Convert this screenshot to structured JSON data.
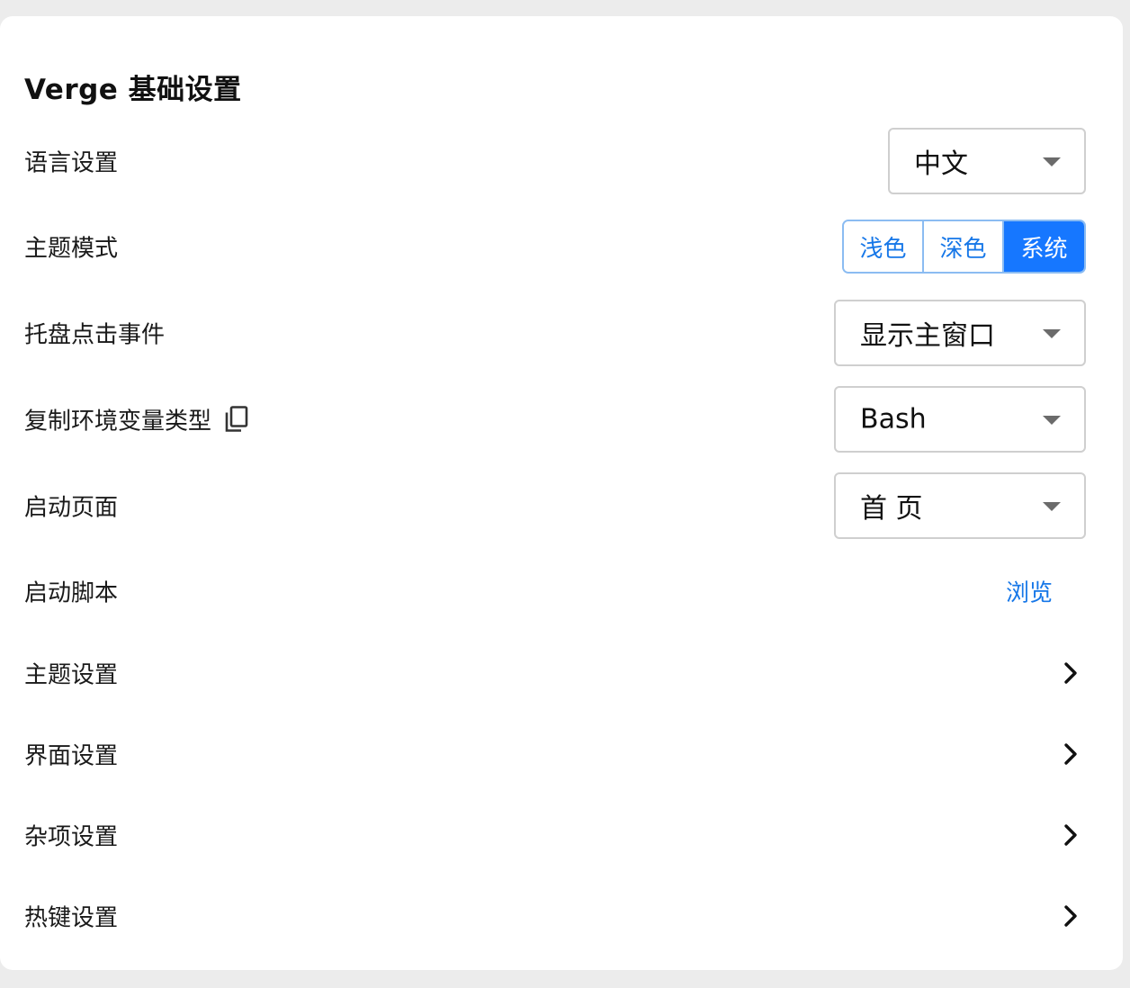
{
  "card": {
    "title": "Verge 基础设置"
  },
  "rows": {
    "language": {
      "label": "语言设置",
      "value": "中文"
    },
    "theme_mode": {
      "label": "主题模式",
      "options": [
        "浅色",
        "深色",
        "系统"
      ],
      "selected": "系统"
    },
    "tray_click": {
      "label": "托盘点击事件",
      "value": "显示主窗口"
    },
    "env_type": {
      "label": "复制环境变量类型",
      "icon": "copy-icon",
      "value": "Bash"
    },
    "start_page": {
      "label": "启动页面",
      "value": "首 页"
    },
    "start_script": {
      "label": "启动脚本",
      "action": "浏览"
    },
    "theme_settings": {
      "label": "主题设置",
      "icon": "chevron-right-icon"
    },
    "ui_settings": {
      "label": "界面设置",
      "icon": "chevron-right-icon"
    },
    "misc_settings": {
      "label": "杂项设置",
      "icon": "chevron-right-icon"
    },
    "hotkey_settings": {
      "label": "热键设置",
      "icon": "chevron-right-icon"
    }
  },
  "colors": {
    "accent": "#1677ff",
    "link": "#1677e8",
    "segment_border": "#8bbcf2",
    "page_background": "#ececec",
    "card_background": "#ffffff"
  }
}
